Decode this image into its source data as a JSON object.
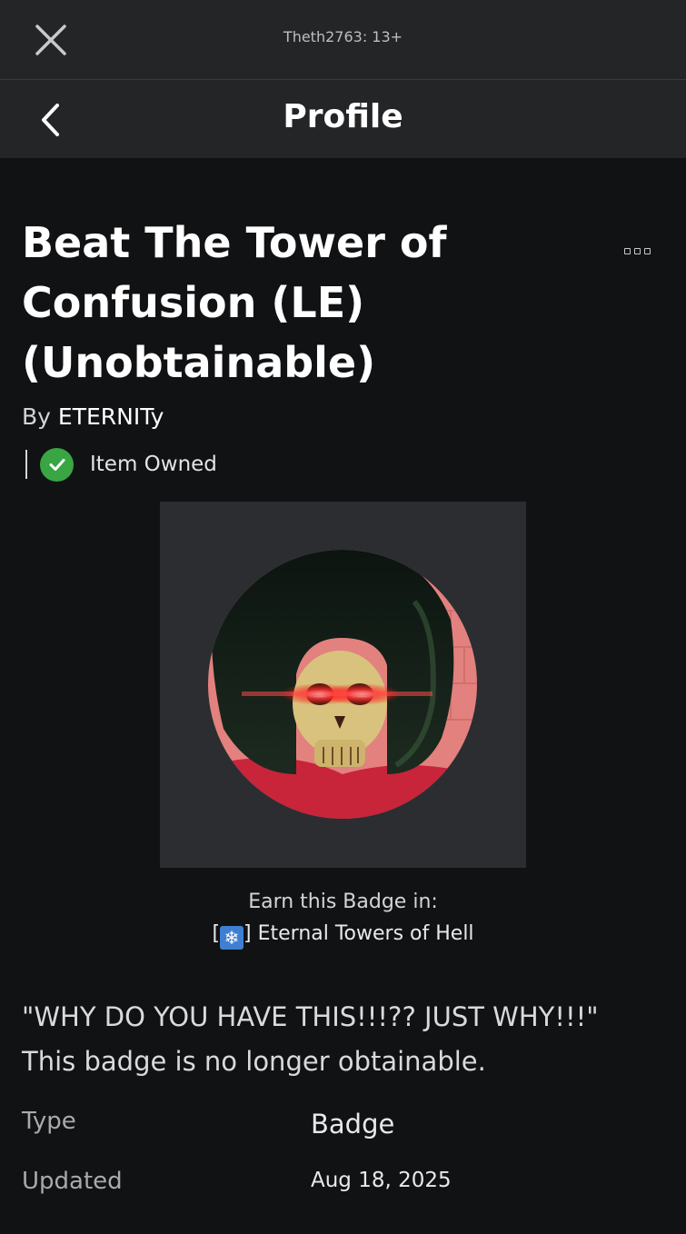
{
  "top_bar": {
    "title": "Theth2763: 13+",
    "close_icon": "close-icon"
  },
  "nav": {
    "title": "Profile",
    "back_icon": "chevron-left-icon"
  },
  "item": {
    "title": "Beat The Tower of Confusion (LE) (Unobtainable)",
    "creator_prefix": "By ",
    "creator_name": "ETERNITy",
    "owned_status": "Item Owned",
    "more_icon": "more-options-icon",
    "thumbnail_icon": "skull-badge-image",
    "earn_label": "Earn this Badge in:",
    "game_prefix": "[",
    "game_emoji": "❄",
    "game_suffix": "] Eternal Towers of Hell",
    "description": "\"WHY DO YOU HAVE THIS!!!?? JUST WHY!!!\" This badge is no longer obtainable."
  },
  "details": [
    {
      "label": "Type",
      "value": "Badge"
    },
    {
      "label": "Updated",
      "value": "Aug 18, 2025"
    }
  ],
  "colors": {
    "background": "#111214",
    "bar": "#232527",
    "owned_green": "#39a543",
    "thumb_frame": "#2b2d31"
  }
}
